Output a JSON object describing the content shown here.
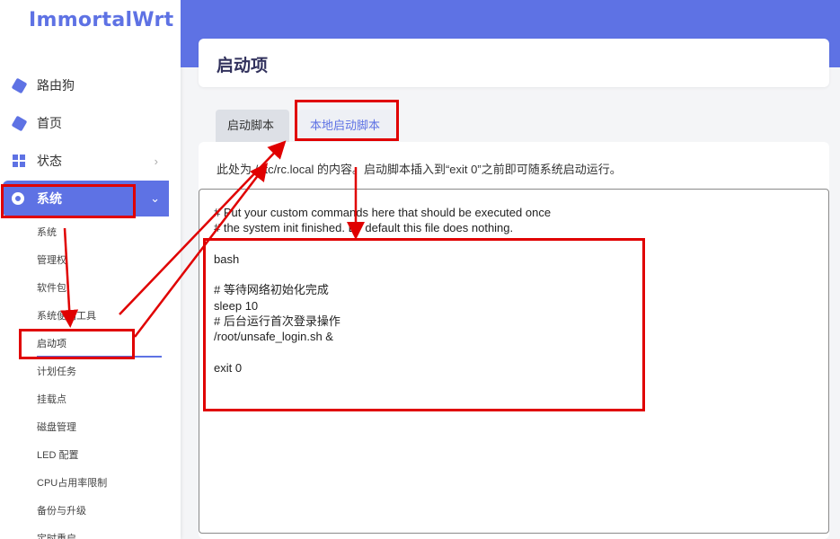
{
  "brand": "ImmortalWrt",
  "nav": {
    "router": "路由狗",
    "home": "首页",
    "status": "状态",
    "system": "系统"
  },
  "submenu": [
    "系统",
    "管理权",
    "软件包",
    "系统便利工具",
    "启动项",
    "计划任务",
    "挂载点",
    "磁盘管理",
    "LED 配置",
    "CPU占用率限制",
    "备份与升级",
    "定时重启"
  ],
  "page_title": "启动项",
  "tabs": {
    "startup_scripts": "启动脚本",
    "local_startup": "本地启动脚本"
  },
  "description": "此处为 /etc/rc.local 的内容。启动脚本插入到“exit 0”之前即可随系统启动运行。",
  "editor_content": "# Put your custom commands here that should be executed once\n# the system init finished. By default this file does nothing.\n\nbash\n\n# 等待网络初始化完成\nsleep 10\n# 后台运行首次登录操作\n/root/unsafe_login.sh &\n\nexit 0",
  "colors": {
    "accent": "#5e72e4",
    "annotation": "#e00000"
  }
}
